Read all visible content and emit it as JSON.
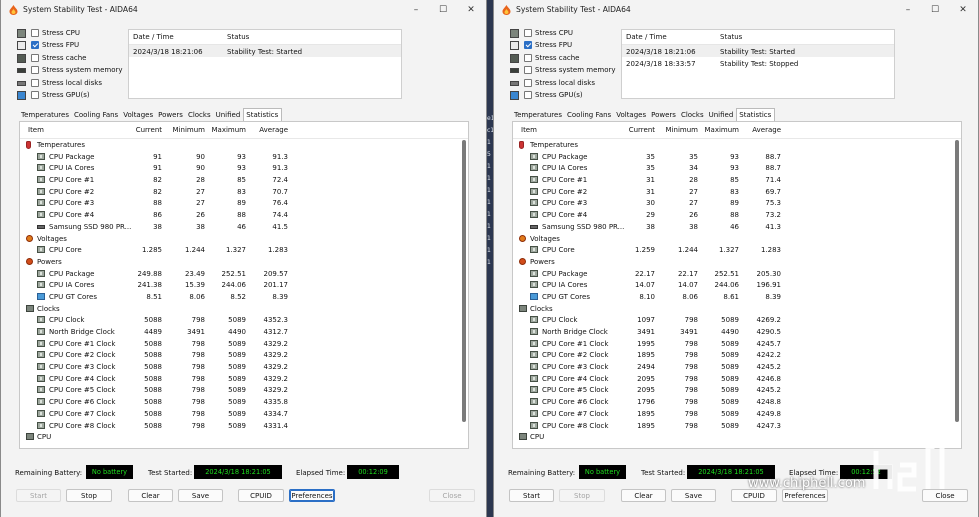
{
  "windows": [
    {
      "title": "System Stability Test - AIDA64",
      "stress": [
        {
          "label": "Stress CPU",
          "checked": false,
          "icon": "cpu-chip-icon"
        },
        {
          "label": "Stress FPU",
          "checked": true,
          "icon": "fpu-chip-icon"
        },
        {
          "label": "Stress cache",
          "checked": false,
          "icon": "cache-icon"
        },
        {
          "label": "Stress system memory",
          "checked": false,
          "icon": "memory-icon"
        },
        {
          "label": "Stress local disks",
          "checked": false,
          "icon": "disk-icon"
        },
        {
          "label": "Stress GPU(s)",
          "checked": false,
          "icon": "monitor-icon"
        }
      ],
      "log": {
        "headers": [
          "Date / Time",
          "Status"
        ],
        "rows": [
          [
            "2024/3/18 18:21:06",
            "Stability Test: Started"
          ]
        ]
      },
      "tabs": [
        "Temperatures",
        "Cooling Fans",
        "Voltages",
        "Powers",
        "Clocks",
        "Unified",
        "Statistics"
      ],
      "active_tab": "Statistics",
      "stats_headers": {
        "item": "Item",
        "current": "Current",
        "minimum": "Minimum",
        "maximum": "Maximum",
        "average": "Average"
      },
      "stats": [
        {
          "kind": "group",
          "icon": "thermometer-icon",
          "label": "Temperatures"
        },
        {
          "kind": "row",
          "icon": "sensor-icon",
          "label": "CPU Package",
          "cur": "91",
          "min": "90",
          "max": "93",
          "avg": "91.3"
        },
        {
          "kind": "row",
          "icon": "sensor-icon",
          "label": "CPU IA Cores",
          "cur": "91",
          "min": "90",
          "max": "93",
          "avg": "91.3"
        },
        {
          "kind": "row",
          "icon": "sensor-icon",
          "label": "CPU Core #1",
          "cur": "82",
          "min": "28",
          "max": "85",
          "avg": "72.4"
        },
        {
          "kind": "row",
          "icon": "sensor-icon",
          "label": "CPU Core #2",
          "cur": "82",
          "min": "27",
          "max": "83",
          "avg": "70.7"
        },
        {
          "kind": "row",
          "icon": "sensor-icon",
          "label": "CPU Core #3",
          "cur": "88",
          "min": "27",
          "max": "89",
          "avg": "76.4"
        },
        {
          "kind": "row",
          "icon": "sensor-icon",
          "label": "CPU Core #4",
          "cur": "86",
          "min": "26",
          "max": "88",
          "avg": "74.4"
        },
        {
          "kind": "row",
          "icon": "ssd-icon",
          "label": "Samsung SSD 980 PR...",
          "cur": "38",
          "min": "38",
          "max": "46",
          "avg": "41.5"
        },
        {
          "kind": "group",
          "icon": "voltage-icon",
          "label": "Voltages"
        },
        {
          "kind": "row",
          "icon": "sensor-icon",
          "label": "CPU Core",
          "cur": "1.285",
          "min": "1.244",
          "max": "1.327",
          "avg": "1.283"
        },
        {
          "kind": "group",
          "icon": "power-icon",
          "label": "Powers"
        },
        {
          "kind": "row",
          "icon": "sensor-icon",
          "label": "CPU Package",
          "cur": "249.88",
          "min": "23.49",
          "max": "252.51",
          "avg": "209.57"
        },
        {
          "kind": "row",
          "icon": "sensor-icon",
          "label": "CPU IA Cores",
          "cur": "241.38",
          "min": "15.39",
          "max": "244.06",
          "avg": "201.17"
        },
        {
          "kind": "row",
          "icon": "gpu-icon",
          "label": "CPU GT Cores",
          "cur": "8.51",
          "min": "8.06",
          "max": "8.52",
          "avg": "8.39"
        },
        {
          "kind": "group",
          "icon": "clock-chip-icon",
          "label": "Clocks"
        },
        {
          "kind": "row",
          "icon": "sensor-icon",
          "label": "CPU Clock",
          "cur": "5088",
          "min": "798",
          "max": "5089",
          "avg": "4352.3"
        },
        {
          "kind": "row",
          "icon": "sensor-icon",
          "label": "North Bridge Clock",
          "cur": "4489",
          "min": "3491",
          "max": "4490",
          "avg": "4312.7"
        },
        {
          "kind": "row",
          "icon": "sensor-icon",
          "label": "CPU Core #1 Clock",
          "cur": "5088",
          "min": "798",
          "max": "5089",
          "avg": "4329.2"
        },
        {
          "kind": "row",
          "icon": "sensor-icon",
          "label": "CPU Core #2 Clock",
          "cur": "5088",
          "min": "798",
          "max": "5089",
          "avg": "4329.2"
        },
        {
          "kind": "row",
          "icon": "sensor-icon",
          "label": "CPU Core #3 Clock",
          "cur": "5088",
          "min": "798",
          "max": "5089",
          "avg": "4329.2"
        },
        {
          "kind": "row",
          "icon": "sensor-icon",
          "label": "CPU Core #4 Clock",
          "cur": "5088",
          "min": "798",
          "max": "5089",
          "avg": "4329.2"
        },
        {
          "kind": "row",
          "icon": "sensor-icon",
          "label": "CPU Core #5 Clock",
          "cur": "5088",
          "min": "798",
          "max": "5089",
          "avg": "4329.2"
        },
        {
          "kind": "row",
          "icon": "sensor-icon",
          "label": "CPU Core #6 Clock",
          "cur": "5088",
          "min": "798",
          "max": "5089",
          "avg": "4335.8"
        },
        {
          "kind": "row",
          "icon": "sensor-icon",
          "label": "CPU Core #7 Clock",
          "cur": "5088",
          "min": "798",
          "max": "5089",
          "avg": "4334.7"
        },
        {
          "kind": "row",
          "icon": "sensor-icon",
          "label": "CPU Core #8 Clock",
          "cur": "5088",
          "min": "798",
          "max": "5089",
          "avg": "4331.4"
        },
        {
          "kind": "group",
          "icon": "cpu-chip-icon",
          "label": "CPU"
        }
      ],
      "bottom": {
        "battery_label": "Remaining Battery:",
        "battery_value": "No battery",
        "started_label": "Test Started:",
        "started_value": "2024/3/18 18:21:05",
        "elapsed_label": "Elapsed Time:",
        "elapsed_value": "00:12:09"
      },
      "buttons": [
        {
          "label": "Start",
          "disabled": true
        },
        {
          "label": "Stop",
          "disabled": false
        },
        {
          "label": "Clear",
          "disabled": false
        },
        {
          "label": "Save",
          "disabled": false
        },
        {
          "label": "CPUID",
          "disabled": false
        },
        {
          "label": "Preferences",
          "disabled": false,
          "focused": true
        },
        {
          "label": "Close",
          "disabled": true
        }
      ]
    },
    {
      "title": "System Stability Test - AIDA64",
      "stress": [
        {
          "label": "Stress CPU",
          "checked": false,
          "icon": "cpu-chip-icon"
        },
        {
          "label": "Stress FPU",
          "checked": true,
          "icon": "fpu-chip-icon"
        },
        {
          "label": "Stress cache",
          "checked": false,
          "icon": "cache-icon"
        },
        {
          "label": "Stress system memory",
          "checked": false,
          "icon": "memory-icon"
        },
        {
          "label": "Stress local disks",
          "checked": false,
          "icon": "disk-icon"
        },
        {
          "label": "Stress GPU(s)",
          "checked": false,
          "icon": "monitor-icon"
        }
      ],
      "log": {
        "headers": [
          "Date / Time",
          "Status"
        ],
        "rows": [
          [
            "2024/3/18 18:21:06",
            "Stability Test: Started"
          ],
          [
            "2024/3/18 18:33:57",
            "Stability Test: Stopped"
          ]
        ]
      },
      "tabs": [
        "Temperatures",
        "Cooling Fans",
        "Voltages",
        "Powers",
        "Clocks",
        "Unified",
        "Statistics"
      ],
      "active_tab": "Statistics",
      "stats_headers": {
        "item": "Item",
        "current": "Current",
        "minimum": "Minimum",
        "maximum": "Maximum",
        "average": "Average"
      },
      "stats": [
        {
          "kind": "group",
          "icon": "thermometer-icon",
          "label": "Temperatures"
        },
        {
          "kind": "row",
          "icon": "sensor-icon",
          "label": "CPU Package",
          "cur": "35",
          "min": "35",
          "max": "93",
          "avg": "88.7"
        },
        {
          "kind": "row",
          "icon": "sensor-icon",
          "label": "CPU IA Cores",
          "cur": "35",
          "min": "34",
          "max": "93",
          "avg": "88.7"
        },
        {
          "kind": "row",
          "icon": "sensor-icon",
          "label": "CPU Core #1",
          "cur": "31",
          "min": "28",
          "max": "85",
          "avg": "71.4"
        },
        {
          "kind": "row",
          "icon": "sensor-icon",
          "label": "CPU Core #2",
          "cur": "31",
          "min": "27",
          "max": "83",
          "avg": "69.7"
        },
        {
          "kind": "row",
          "icon": "sensor-icon",
          "label": "CPU Core #3",
          "cur": "30",
          "min": "27",
          "max": "89",
          "avg": "75.3"
        },
        {
          "kind": "row",
          "icon": "sensor-icon",
          "label": "CPU Core #4",
          "cur": "29",
          "min": "26",
          "max": "88",
          "avg": "73.2"
        },
        {
          "kind": "row",
          "icon": "ssd-icon",
          "label": "Samsung SSD 980 PR...",
          "cur": "38",
          "min": "38",
          "max": "46",
          "avg": "41.3"
        },
        {
          "kind": "group",
          "icon": "voltage-icon",
          "label": "Voltages"
        },
        {
          "kind": "row",
          "icon": "sensor-icon",
          "label": "CPU Core",
          "cur": "1.259",
          "min": "1.244",
          "max": "1.327",
          "avg": "1.283"
        },
        {
          "kind": "group",
          "icon": "power-icon",
          "label": "Powers"
        },
        {
          "kind": "row",
          "icon": "sensor-icon",
          "label": "CPU Package",
          "cur": "22.17",
          "min": "22.17",
          "max": "252.51",
          "avg": "205.30"
        },
        {
          "kind": "row",
          "icon": "sensor-icon",
          "label": "CPU IA Cores",
          "cur": "14.07",
          "min": "14.07",
          "max": "244.06",
          "avg": "196.91"
        },
        {
          "kind": "row",
          "icon": "gpu-icon",
          "label": "CPU GT Cores",
          "cur": "8.10",
          "min": "8.06",
          "max": "8.61",
          "avg": "8.39"
        },
        {
          "kind": "group",
          "icon": "clock-chip-icon",
          "label": "Clocks"
        },
        {
          "kind": "row",
          "icon": "sensor-icon",
          "label": "CPU Clock",
          "cur": "1097",
          "min": "798",
          "max": "5089",
          "avg": "4269.2"
        },
        {
          "kind": "row",
          "icon": "sensor-icon",
          "label": "North Bridge Clock",
          "cur": "3491",
          "min": "3491",
          "max": "4490",
          "avg": "4290.5"
        },
        {
          "kind": "row",
          "icon": "sensor-icon",
          "label": "CPU Core #1 Clock",
          "cur": "1995",
          "min": "798",
          "max": "5089",
          "avg": "4245.7"
        },
        {
          "kind": "row",
          "icon": "sensor-icon",
          "label": "CPU Core #2 Clock",
          "cur": "1895",
          "min": "798",
          "max": "5089",
          "avg": "4242.2"
        },
        {
          "kind": "row",
          "icon": "sensor-icon",
          "label": "CPU Core #3 Clock",
          "cur": "2494",
          "min": "798",
          "max": "5089",
          "avg": "4245.2"
        },
        {
          "kind": "row",
          "icon": "sensor-icon",
          "label": "CPU Core #4 Clock",
          "cur": "2095",
          "min": "798",
          "max": "5089",
          "avg": "4246.8"
        },
        {
          "kind": "row",
          "icon": "sensor-icon",
          "label": "CPU Core #5 Clock",
          "cur": "2095",
          "min": "798",
          "max": "5089",
          "avg": "4245.2"
        },
        {
          "kind": "row",
          "icon": "sensor-icon",
          "label": "CPU Core #6 Clock",
          "cur": "1796",
          "min": "798",
          "max": "5089",
          "avg": "4248.8"
        },
        {
          "kind": "row",
          "icon": "sensor-icon",
          "label": "CPU Core #7 Clock",
          "cur": "1895",
          "min": "798",
          "max": "5089",
          "avg": "4249.8"
        },
        {
          "kind": "row",
          "icon": "sensor-icon",
          "label": "CPU Core #8 Clock",
          "cur": "1895",
          "min": "798",
          "max": "5089",
          "avg": "4247.3"
        },
        {
          "kind": "group",
          "icon": "cpu-chip-icon",
          "label": "CPU"
        }
      ],
      "bottom": {
        "battery_label": "Remaining Battery:",
        "battery_value": "No battery",
        "started_label": "Test Started:",
        "started_value": "2024/3/18 18:21:05",
        "elapsed_label": "Elapsed Time:",
        "elapsed_value": "00:12:52"
      },
      "buttons": [
        {
          "label": "Start",
          "disabled": false
        },
        {
          "label": "Stop",
          "disabled": true
        },
        {
          "label": "Clear",
          "disabled": false
        },
        {
          "label": "Save",
          "disabled": false
        },
        {
          "label": "CPUID",
          "disabled": false
        },
        {
          "label": "Preferences",
          "disabled": false,
          "focused": false
        },
        {
          "label": "Close",
          "disabled": false
        }
      ]
    }
  ],
  "background_fragments": [
    "e1",
    "c1",
    "1",
    "5",
    "1",
    "1",
    "1",
    "1",
    "1",
    "1",
    "1",
    "1",
    "1"
  ],
  "watermark": {
    "logo_text": "chip hell",
    "url": "www.chiphell.com"
  },
  "colors": {
    "lcd_text": "#1edf1e",
    "checkbox_accent": "#2b6fc6"
  }
}
